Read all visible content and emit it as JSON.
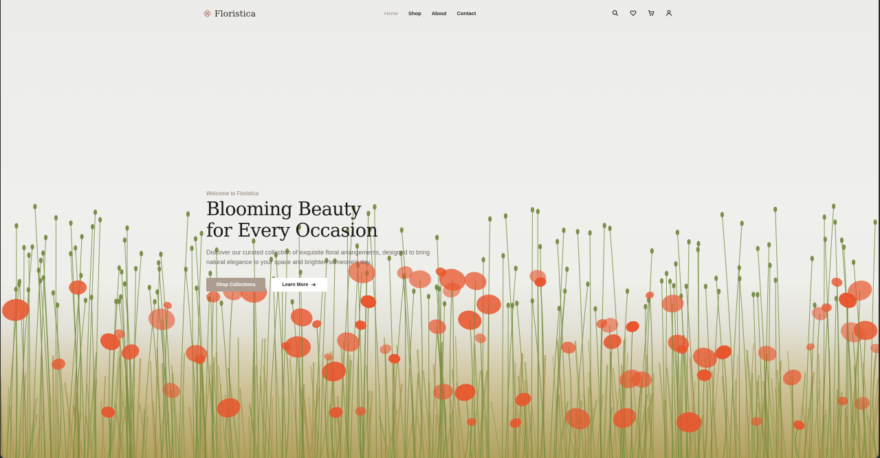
{
  "brand": {
    "name": "Floristica",
    "accent": "#b27d72"
  },
  "nav": {
    "home": "Home",
    "shop": "Shop",
    "about": "About",
    "contact": "Contact",
    "active_color": "#9c8f82"
  },
  "toolbar": {
    "icons": [
      "search-icon",
      "heart-icon",
      "cart-icon",
      "user-icon"
    ]
  },
  "hero": {
    "eyebrow": "Welcome to Floristica",
    "title_line1": "Blooming Beauty",
    "title_line2": "for Every Occasion",
    "description": "Discover our curated collection of exquisite floral arrangements, designed to bring natural elegance to your space and brighten someone's day.",
    "primary_cta": "Shop Collections",
    "secondary_cta": "Learn More",
    "primary_color": "#ad9d90",
    "flower_color": "#e8542c",
    "stem_color": "#6f8a3a"
  }
}
